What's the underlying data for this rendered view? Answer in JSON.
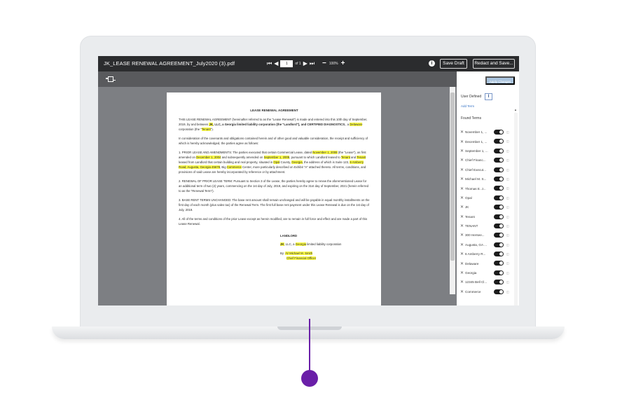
{
  "viewer": {
    "file_title": "JK_LEASE RENEWAL AGREEMENT_July2020 (3).pdf",
    "page_value": "1",
    "page_of": "of 1",
    "zoom_level": "100%",
    "save_draft_label": "Save Draft",
    "redact_save_label": "Redact and Save..."
  },
  "document": {
    "title": "LEASE RENEWAL AGREEMENT",
    "p1_a": "THIS LEASE RENEWAL AGREEMENT (hereinafter referred to as the \"Lease Renewal\") is made and entered into this 10th day of September, 2019, by and between ",
    "p1_jk": "JK",
    "p1_b": ", LLC, a Georgia limited liability corporation (the \"Landlord\"), and ",
    "p1_c": "CERTIFIED DIAGNOSTICS.",
    "p1_d": ", a ",
    "p1_delaware": "Delaware",
    "p1_e": " corporation (the \"",
    "p1_tenant": "Tenant",
    "p1_f": "\").",
    "p2": "In consideration of the covenants and obligations contained herein and of other good and valuable consideration, the receipt and sufficiency of which is hereby acknowledged, the parties agree as follows:",
    "p3_a": "1. PRIOR LEASE AND AMENDMENTS: The parties executed that certain Commercial Lease, dated ",
    "p3_nov": "November 1, 2008",
    "p3_b": " (the \"Lease\"), as first amended on ",
    "p3_dec": "December 1, 2004",
    "p3_c": " and subsequently amended on ",
    "p3_sep": "September 1, 2009",
    "p3_d": ", pursuant to which Landlord leased to ",
    "p3_tenant": "Tenant",
    "p3_e": " and ",
    "p3_tenant2": "Tenant",
    "p3_f": " leased from Landlord that certain building and real property, situated in ",
    "p3_opal": "Opal",
    "p3_g": " County, ",
    "p3_georgia": "Georgia",
    "p3_h": ", the address of which is Suite 123, ",
    "p3_addr": "6 Amberry Road, Augusta, Georgia 45678",
    "p3_i": ", Big ",
    "p3_commerce": "Commerce",
    "p3_j": " Center, more particularly described on Exhibit \"A\" attached thereto. All terms, conditions, and provisions of said Lease are hereby incorporated by reference or by attachment.",
    "p4": "2. RENEWAL OF PRIOR LEASE TERM: Pursuant to Section 3 of the Lease, the parties hereby agree to renew the aforementioned Lease for an additional term of two (2) years, commencing on the 1st day of July, 2019, and expiring on the 31st day of September, 2021 (herein referred to as the \"Renewal Term\").",
    "p5": "3. BASE RENT TERMS UNCHANGED: The base rent amount shall remain unchanged and will be payable in equal monthly installments on the first day of each month (plus sales tax) of the Renewal Term. The first full base rent payment under this Lease Renewal is due on the 1st day of July, 2019.",
    "p6": "4. All of the terms and conditions of the prior Lease except as herein modified, are to remain in full force and effect and are made a part of this Lease Renewal.",
    "sig_head": "LANDLORD",
    "sig_jk": "JK",
    "sig_a": ", LLC, a ",
    "sig_georgia": "Georgia",
    "sig_b": " limited liability corporation",
    "sig_by": "By: ",
    "sig_name": "/s/ Michael M. Smith",
    "sig_role": "Chief Financial Officer"
  },
  "panel": {
    "apply_label": "Apply Changes",
    "user_defined_label": "User Defined",
    "add_term_label": "Add Term",
    "found_terms_label": "Found Terms",
    "terms": [
      {
        "name": "November 1, ..."
      },
      {
        "name": "December 1, ..."
      },
      {
        "name": "September 1, ..."
      },
      {
        "name": "Chief Financ..."
      },
      {
        "name": "Chief Execut..."
      },
      {
        "name": "Michael M. S..."
      },
      {
        "name": "Thomas E. J..."
      },
      {
        "name": "Opal"
      },
      {
        "name": "JK"
      },
      {
        "name": "Tenant"
      },
      {
        "name": "TENANT"
      },
      {
        "name": "300 Hersee..."
      },
      {
        "name": "Augusta, GA ..."
      },
      {
        "name": "6 Amberry R..."
      },
      {
        "name": "Delaware"
      },
      {
        "name": "Georgia"
      },
      {
        "name": "12345 Bell Cl..."
      },
      {
        "name": "Commerce"
      }
    ]
  },
  "colors": {
    "accent_purple": "#6a1fa8",
    "highlight": "#ffff4a",
    "topbar": "#2b2c2e"
  }
}
